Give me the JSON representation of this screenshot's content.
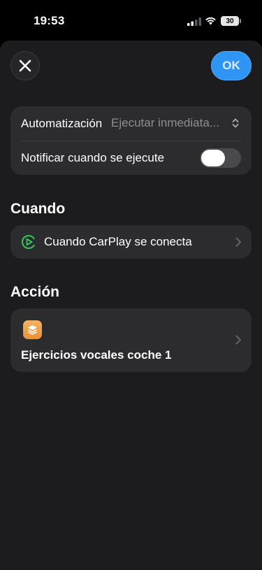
{
  "status_bar": {
    "time": "19:53",
    "battery_level": "30"
  },
  "header": {
    "close_icon": "xmark-icon",
    "ok_label": "OK",
    "ok_color": "#2f95f5"
  },
  "settings": {
    "automation_label": "Automatización",
    "automation_value": "Ejecutar inmediata...",
    "notify_label": "Notificar cuando se ejecute",
    "notify_enabled": false
  },
  "when_section": {
    "title": "Cuando",
    "trigger_label": "Cuando CarPlay se conecta",
    "trigger_icon": "carplay-icon",
    "trigger_icon_color": "#34c759"
  },
  "action_section": {
    "title": "Acción",
    "shortcut_icon": "shortcuts-icon",
    "shortcut_name": "Ejercicios vocales coche 1",
    "shortcut_color": "#f0a54b"
  }
}
